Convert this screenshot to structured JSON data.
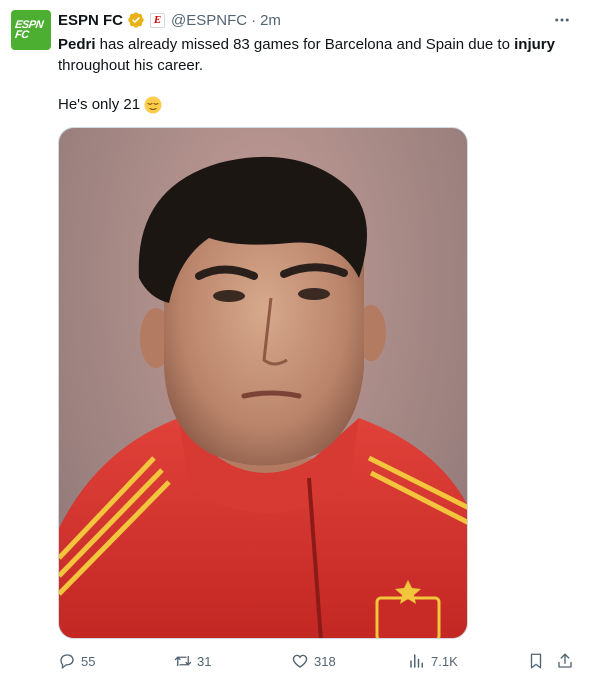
{
  "author": {
    "avatar_line1": "ESPN",
    "avatar_line2": "FC",
    "name": "ESPN FC",
    "handle": "@ESPNFC",
    "separator": "·",
    "time": "2m",
    "affiliate_badge": "E"
  },
  "tweet": {
    "segments": [
      {
        "text": "Pedri",
        "bold": true
      },
      {
        "text": " has already missed 83 games for Barcelona and Spain due to ",
        "bold": false
      },
      {
        "text": "injury",
        "bold": true
      },
      {
        "text": " throughout his career.",
        "bold": false
      }
    ],
    "second_line": "He's only 21",
    "emoji": "relieved-face-emoji"
  },
  "icons": [
    "more-icon",
    "verified-badge-icon",
    "reply-icon",
    "retweet-icon",
    "like-icon",
    "views-icon",
    "bookmark-icon",
    "share-icon"
  ],
  "actions": {
    "replies": "55",
    "retweets": "31",
    "likes": "318",
    "views": "7.1K"
  },
  "colors": {
    "avatar_bg": "#4caf32",
    "verified_gold": "#e8b319",
    "muted_text": "#536471",
    "jersey_red": "#d2322d",
    "stripe_yellow": "#f2c53d"
  }
}
